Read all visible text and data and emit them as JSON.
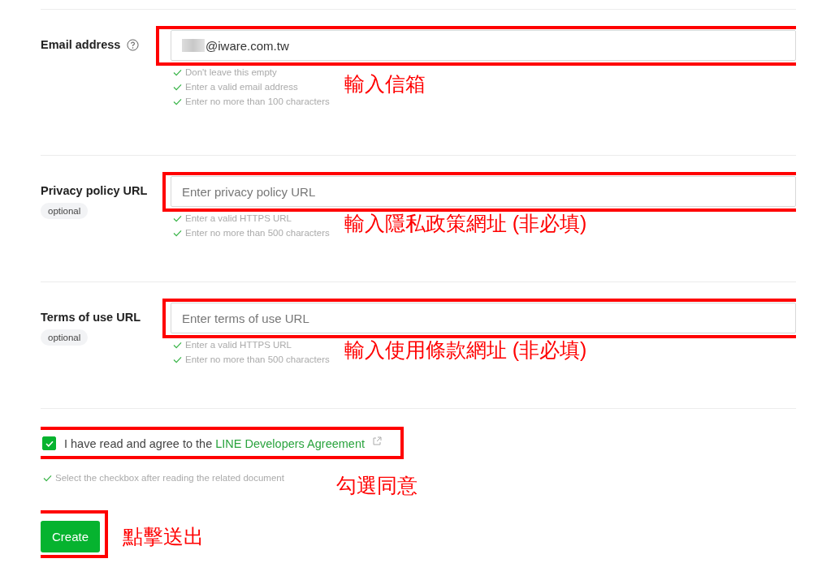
{
  "fields": [
    {
      "label": "Email address",
      "help_icon": true,
      "optional": false,
      "value": "@iware.com.tw",
      "redacted": true,
      "hints": [
        "Don't leave this empty",
        "Enter a valid email address",
        "Enter no more than 100 characters"
      ],
      "note": "輸入信箱"
    },
    {
      "label": "Privacy policy URL",
      "help_icon": false,
      "optional": true,
      "optional_label": "optional",
      "redacted": false,
      "placeholder": "Enter privacy policy URL",
      "hints": [
        "Enter a valid HTTPS URL",
        "Enter no more than 500 characters"
      ],
      "note": "輸入隱私政策網址 (非必填)"
    },
    {
      "label": "Terms of use URL",
      "help_icon": false,
      "optional": true,
      "optional_label": "optional",
      "redacted": false,
      "placeholder": "Enter terms of use URL",
      "hints": [
        "Enter a valid HTTPS URL",
        "Enter no more than 500 characters"
      ],
      "note": "輸入使用條款網址 (非必填)"
    }
  ],
  "agreement": {
    "checked": true,
    "text": "I have read and agree to the ",
    "link": "LINE Developers Agreement",
    "hint": "Select the checkbox after reading the related document",
    "note": "勾選同意"
  },
  "submit": {
    "label": "Create",
    "note": "點擊送出"
  }
}
